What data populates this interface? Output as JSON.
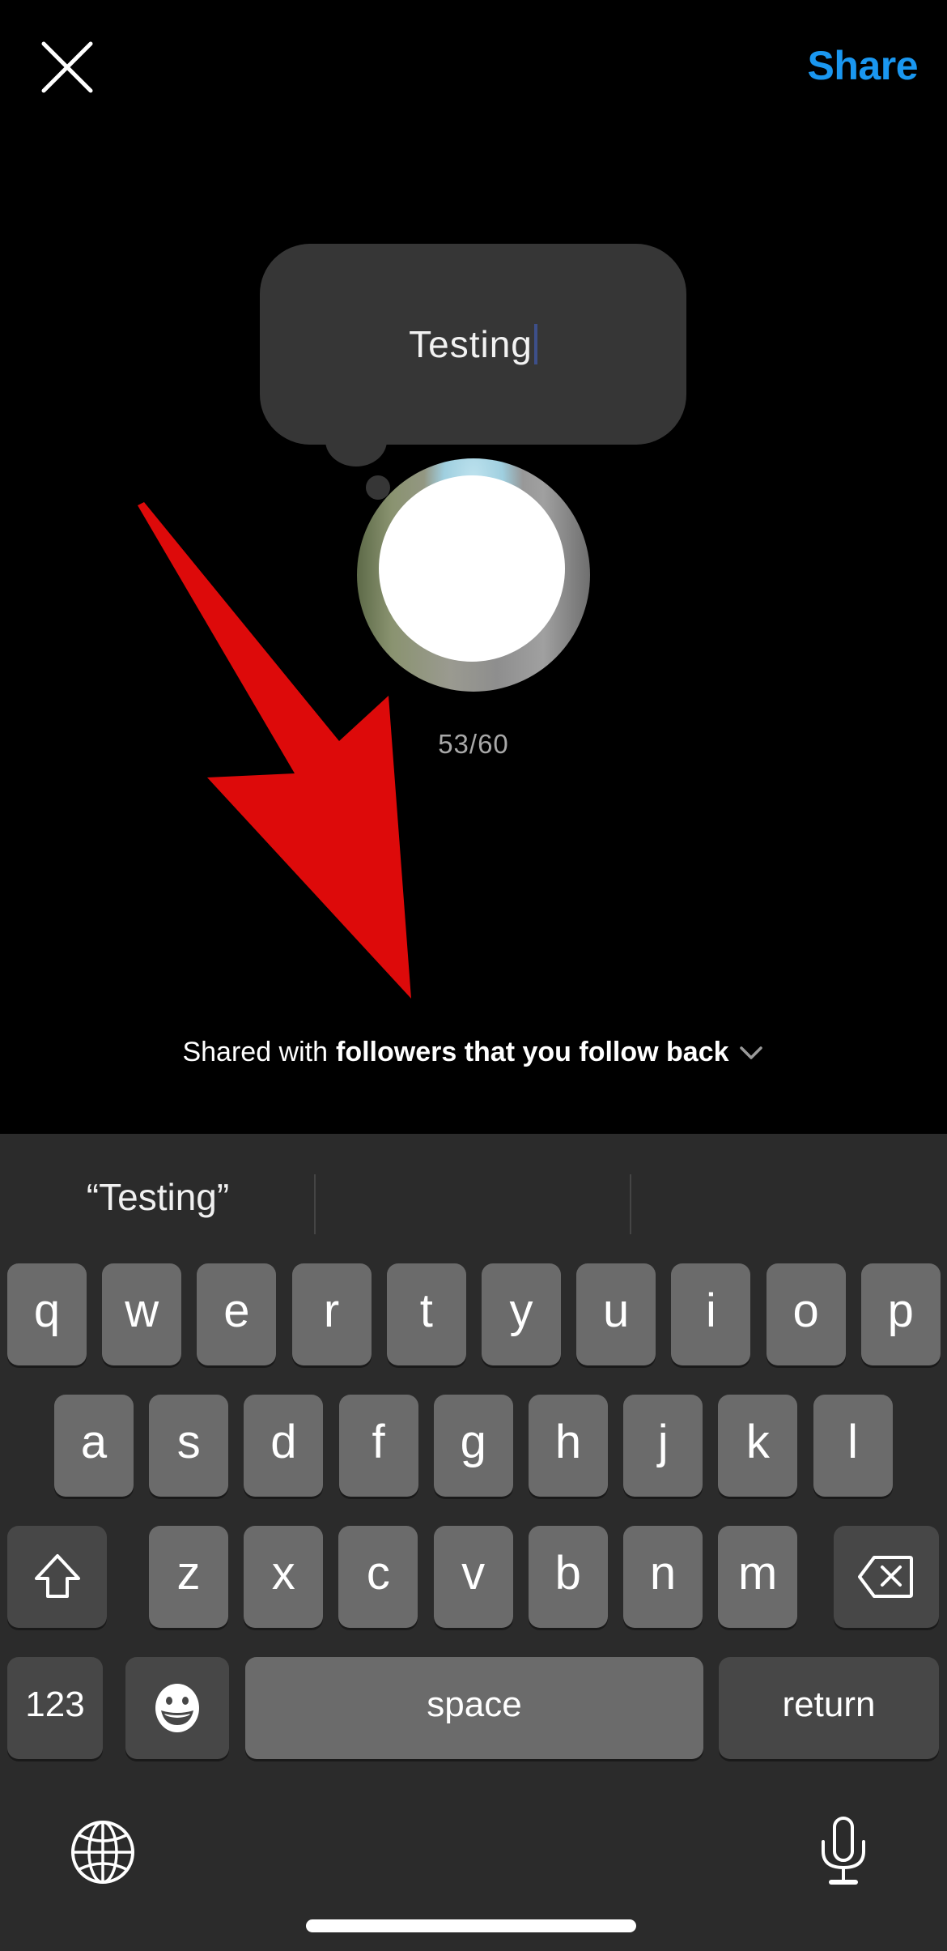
{
  "header": {
    "close_icon": "close-icon",
    "share_label": "Share",
    "share_color": "#1a97f0"
  },
  "note": {
    "text": "Testing",
    "char_count": "53/60",
    "bubble_color": "#363636"
  },
  "audience": {
    "prefix": "Shared with",
    "value": "followers that you follow back",
    "chevron_icon": "chevron-down-icon"
  },
  "annotation": {
    "arrow_color": "#dd0a0a"
  },
  "keyboard": {
    "suggestions": [
      "“Testing”",
      "",
      ""
    ],
    "row1": [
      "q",
      "w",
      "e",
      "r",
      "t",
      "y",
      "u",
      "i",
      "o",
      "p"
    ],
    "row2": [
      "a",
      "s",
      "d",
      "f",
      "g",
      "h",
      "j",
      "k",
      "l"
    ],
    "row3": [
      "z",
      "x",
      "c",
      "v",
      "b",
      "n",
      "m"
    ],
    "numbers_label": "123",
    "space_label": "space",
    "return_label": "return",
    "shift_icon": "shift-icon",
    "delete_icon": "delete-icon",
    "emoji_icon": "emoji-icon",
    "globe_icon": "globe-icon",
    "mic_icon": "microphone-icon"
  }
}
